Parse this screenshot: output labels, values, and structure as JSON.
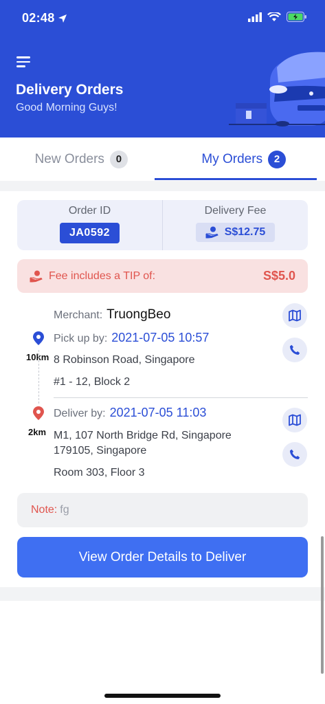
{
  "status_bar": {
    "time": "02:48"
  },
  "header": {
    "title": "Delivery Orders",
    "subtitle": "Good Morning Guys!",
    "menu_icon": "menu-icon"
  },
  "tabs": [
    {
      "label": "New Orders",
      "count": "0",
      "active": false
    },
    {
      "label": "My Orders",
      "count": "2",
      "active": true
    }
  ],
  "order": {
    "order_id_label": "Order ID",
    "order_id": "JA0592",
    "fee_label": "Delivery Fee",
    "fee": "S$12.75",
    "tip_text": "Fee includes a TIP of:",
    "tip_value": "S$5.0"
  },
  "pickup": {
    "merchant_label": "Merchant:",
    "merchant": "TruongBeo",
    "by_label": "Pick up by:",
    "time": "2021-07-05 10:57",
    "distance": "10km",
    "address": "8 Robinson Road, Singapore",
    "unit": "#1 - 12, Block 2"
  },
  "dropoff": {
    "by_label": "Deliver by:",
    "time": "2021-07-05 11:03",
    "distance": "2km",
    "address_line1": "M1, 107 North Bridge Rd, Singapore",
    "address_line2": "179105, Singapore",
    "unit": "Room 303, Floor 3"
  },
  "note": {
    "label": "Note:",
    "value": "fg"
  },
  "action": {
    "label": "View Order Details to Deliver"
  },
  "colors": {
    "primary": "#2b4ed6",
    "button": "#3f6ff2",
    "danger": "#e0554e"
  }
}
